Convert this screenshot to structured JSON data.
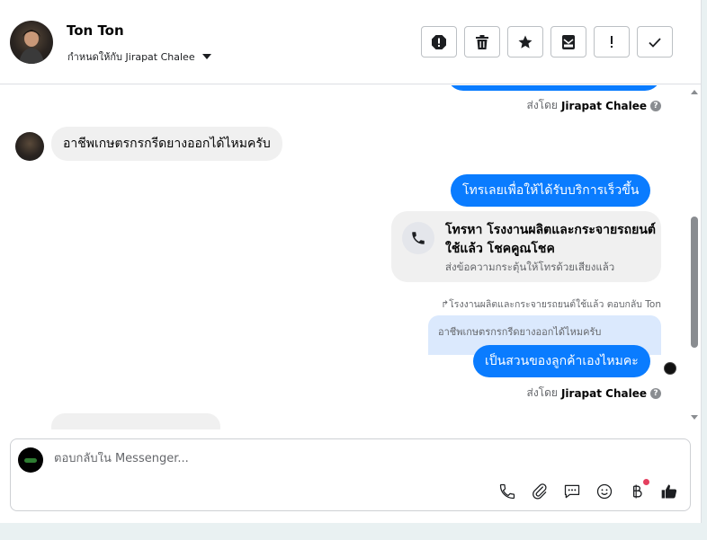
{
  "header": {
    "contact_name": "Ton Ton",
    "assign_label": "กำหนดให้กับ Jirapat Chalee"
  },
  "messages": {
    "sent_by_prefix": "ส่งโดย",
    "sent_by_name": "Jirapat Chalee",
    "incoming_1": "อาชีพเกษตรกรกรีดยางออกได้ไหมครับ",
    "outgoing_1": "โทรเลยเพื่อให้ได้รับบริการเร็วขึ้น",
    "call_card_title": "โทรหา โรงงานผลิตและกระจายรถยนต์ใช้แล้ว โชคคูณโชค",
    "call_card_subtitle": "ส่งข้อความกระตุ้นให้โทรด้วยเสียงแล้ว",
    "reply_note": "โรงงานผลิตและกระจายรถยนต์ใช้แล้ว ตอบกลับ Ton",
    "quoted_text": "อาชีพเกษตรกรกรีดยางออกได้ไหมครับ",
    "outgoing_2": "เป็นสวนของลูกค้าเองไหมคะ"
  },
  "composer": {
    "placeholder": "ตอบกลับใน Messenger..."
  },
  "colors": {
    "accent_blue": "#0a7cff",
    "bubble_gray": "#f0f0f0",
    "quoted_bg": "#dbe9fd",
    "notification_dot": "#e4405f"
  },
  "icons": {
    "toolbar": [
      "spam-icon",
      "trash-icon",
      "star-icon",
      "mark-unread-icon",
      "important-icon",
      "check-icon"
    ],
    "composer": [
      "phone-icon",
      "paperclip-icon",
      "chat-icon",
      "emoji-icon",
      "baht-icon",
      "thumbs-up-icon"
    ]
  }
}
